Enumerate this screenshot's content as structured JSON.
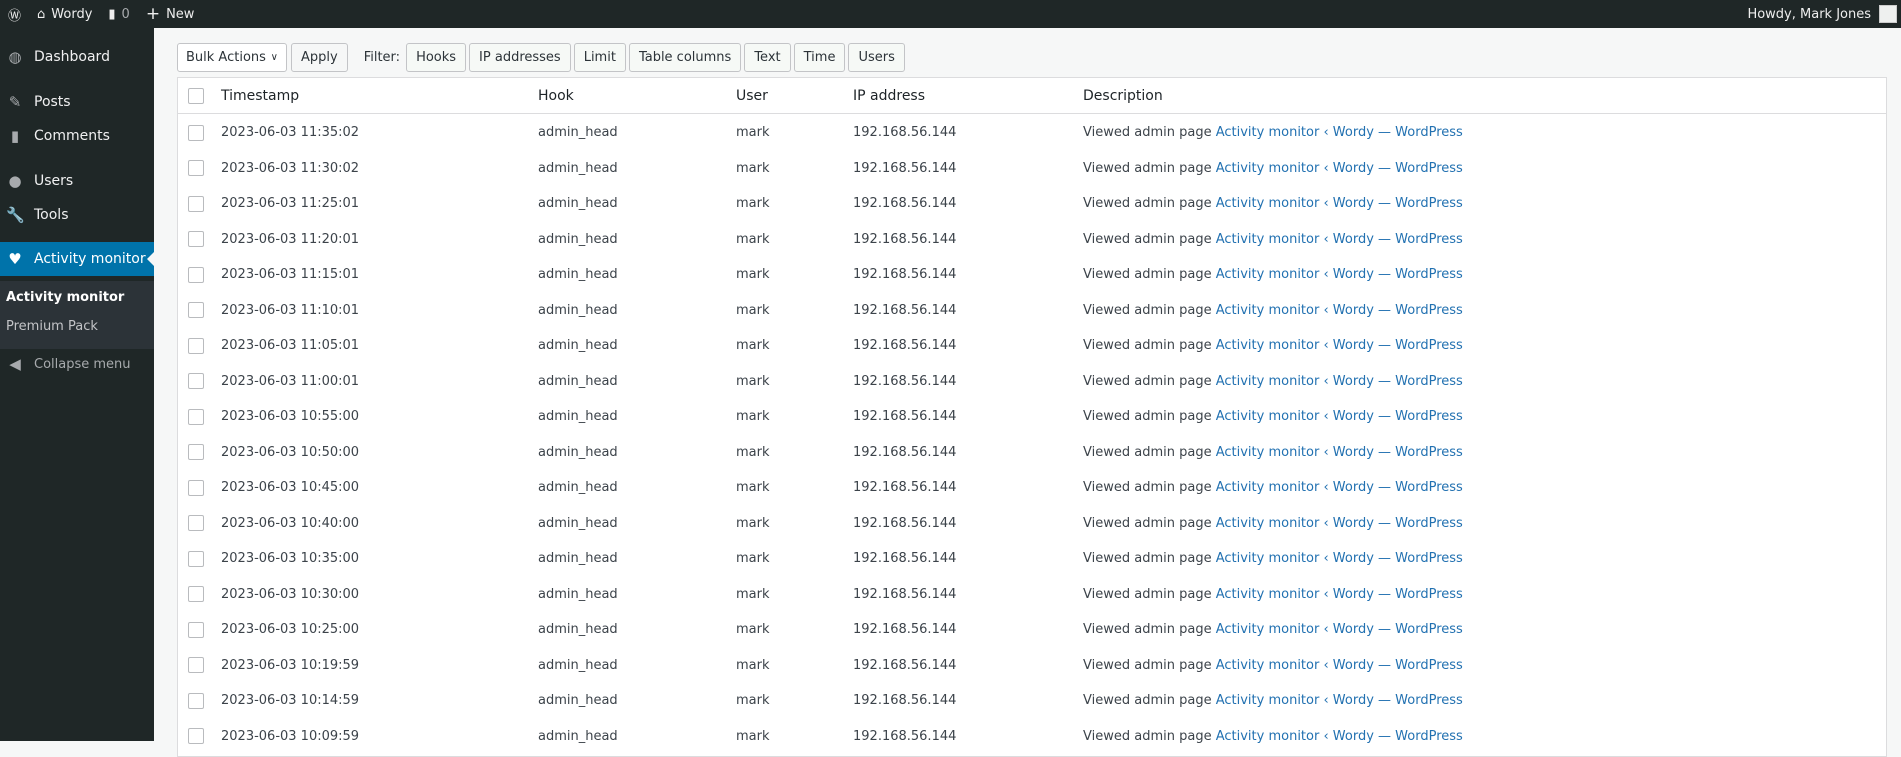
{
  "adminbar": {
    "site": "Wordy",
    "comments": "0",
    "new": "New",
    "howdy": "Howdy, Mark Jones"
  },
  "sidebar": {
    "items": [
      {
        "label": "Dashboard",
        "icon": "dashboard-icon"
      },
      {
        "label": "Posts",
        "icon": "pin-icon"
      },
      {
        "label": "Comments",
        "icon": "comment-icon"
      },
      {
        "label": "Users",
        "icon": "user-icon"
      },
      {
        "label": "Tools",
        "icon": "wrench-icon"
      },
      {
        "label": "Activity monitor",
        "icon": "heart-pulse-icon",
        "active": true
      }
    ],
    "submenu": [
      "Activity monitor",
      "Premium Pack"
    ],
    "collapse": "Collapse menu"
  },
  "toolbar": {
    "bulk": "Bulk Actions",
    "apply": "Apply",
    "filter_label": "Filter:",
    "filters": [
      "Hooks",
      "IP addresses",
      "Limit",
      "Table columns",
      "Text",
      "Time",
      "Users"
    ]
  },
  "table": {
    "columns": [
      "Timestamp",
      "Hook",
      "User",
      "IP address",
      "Description"
    ],
    "desc_prefix": "Viewed admin page",
    "desc_link": "Activity monitor ‹ Wordy — WordPress",
    "rows": [
      [
        "2023-06-03 11:35:02",
        "admin_head",
        "mark",
        "192.168.56.144"
      ],
      [
        "2023-06-03 11:30:02",
        "admin_head",
        "mark",
        "192.168.56.144"
      ],
      [
        "2023-06-03 11:25:01",
        "admin_head",
        "mark",
        "192.168.56.144"
      ],
      [
        "2023-06-03 11:20:01",
        "admin_head",
        "mark",
        "192.168.56.144"
      ],
      [
        "2023-06-03 11:15:01",
        "admin_head",
        "mark",
        "192.168.56.144"
      ],
      [
        "2023-06-03 11:10:01",
        "admin_head",
        "mark",
        "192.168.56.144"
      ],
      [
        "2023-06-03 11:05:01",
        "admin_head",
        "mark",
        "192.168.56.144"
      ],
      [
        "2023-06-03 11:00:01",
        "admin_head",
        "mark",
        "192.168.56.144"
      ],
      [
        "2023-06-03 10:55:00",
        "admin_head",
        "mark",
        "192.168.56.144"
      ],
      [
        "2023-06-03 10:50:00",
        "admin_head",
        "mark",
        "192.168.56.144"
      ],
      [
        "2023-06-03 10:45:00",
        "admin_head",
        "mark",
        "192.168.56.144"
      ],
      [
        "2023-06-03 10:40:00",
        "admin_head",
        "mark",
        "192.168.56.144"
      ],
      [
        "2023-06-03 10:35:00",
        "admin_head",
        "mark",
        "192.168.56.144"
      ],
      [
        "2023-06-03 10:30:00",
        "admin_head",
        "mark",
        "192.168.56.144"
      ],
      [
        "2023-06-03 10:25:00",
        "admin_head",
        "mark",
        "192.168.56.144"
      ],
      [
        "2023-06-03 10:19:59",
        "admin_head",
        "mark",
        "192.168.56.144"
      ],
      [
        "2023-06-03 10:14:59",
        "admin_head",
        "mark",
        "192.168.56.144"
      ],
      [
        "2023-06-03 10:09:59",
        "admin_head",
        "mark",
        "192.168.56.144"
      ]
    ]
  }
}
